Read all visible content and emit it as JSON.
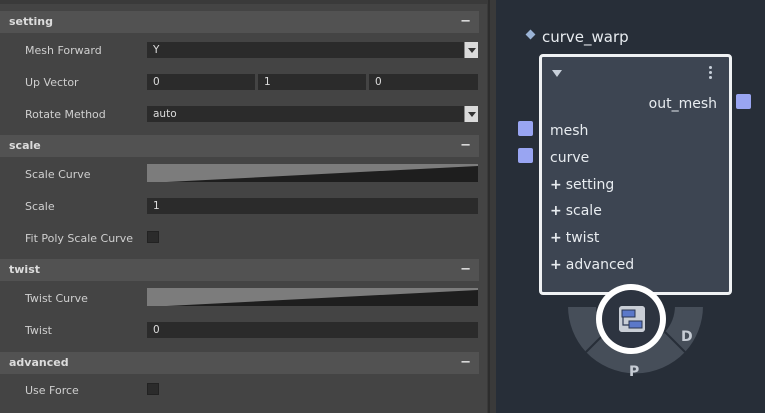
{
  "attribute_editor": {
    "sections": {
      "setting": {
        "title": "setting",
        "collapse_label": "−",
        "mesh_forward": {
          "label": "Mesh Forward",
          "value": "Y"
        },
        "up_vector": {
          "label": "Up Vector",
          "x": "0",
          "y": "1",
          "z": "0"
        },
        "rotate_method": {
          "label": "Rotate Method",
          "value": "auto"
        }
      },
      "scale": {
        "title": "scale",
        "collapse_label": "−",
        "scale_curve": {
          "label": "Scale Curve"
        },
        "scale": {
          "label": "Scale",
          "value": "1"
        },
        "fit_poly_scale_curve": {
          "label": "Fit Poly Scale Curve",
          "checked": false
        }
      },
      "twist": {
        "title": "twist",
        "collapse_label": "−",
        "twist_curve": {
          "label": "Twist Curve"
        },
        "twist": {
          "label": "Twist",
          "value": "0"
        }
      },
      "advanced": {
        "title": "advanced",
        "collapse_label": "−",
        "use_force": {
          "label": "Use Force",
          "checked": false
        }
      }
    }
  },
  "node": {
    "title": "curve_warp",
    "output": "out_mesh",
    "inputs": [
      "mesh",
      "curve"
    ],
    "expanders": [
      "setting",
      "scale",
      "twist",
      "advanced"
    ],
    "wheel": {
      "left": "D",
      "bottom": "P"
    },
    "colors": {
      "port": "#99a5f2",
      "body": "#3d4552",
      "background": "#272e38"
    }
  }
}
